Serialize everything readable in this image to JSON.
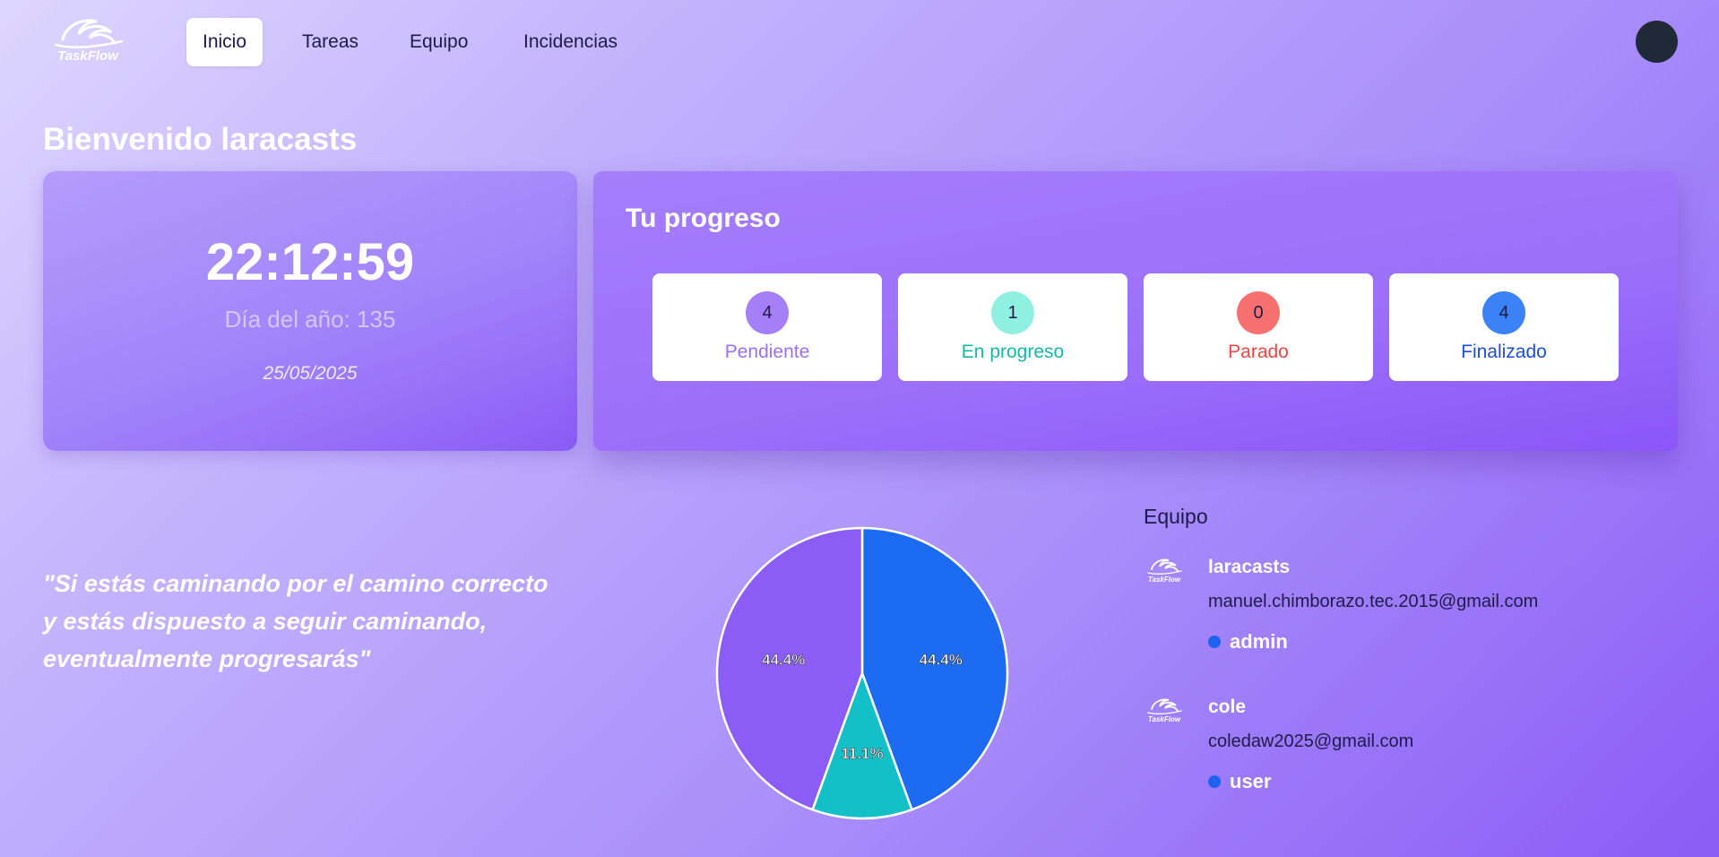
{
  "brand": {
    "logo_text": "TaskFlow"
  },
  "nav": {
    "items": [
      {
        "label": "Inicio",
        "active": true
      },
      {
        "label": "Tareas",
        "active": false
      },
      {
        "label": "Equipo",
        "active": false
      },
      {
        "label": "Incidencias",
        "active": false
      }
    ]
  },
  "welcome": "Bienvenido laracasts",
  "clock": {
    "time": "22:12:59",
    "day_of_year": "Día del año: 135",
    "date": "25/05/2025"
  },
  "progress": {
    "title": "Tu progreso",
    "stats": [
      {
        "count": "4",
        "label": "Pendiente",
        "color": "#a47ff8",
        "label_color": "#9a71f3"
      },
      {
        "count": "1",
        "label": "En progreso",
        "color": "#8ff0e0",
        "label_color": "#14b8a6"
      },
      {
        "count": "0",
        "label": "Parado",
        "color": "#f87171",
        "label_color": "#ef4444"
      },
      {
        "count": "4",
        "label": "Finalizado",
        "color": "#3b82f6",
        "label_color": "#1d4ed8"
      }
    ]
  },
  "quote": "\"Si estás caminando por el camino correcto y estás dispuesto a seguir caminando, eventualmente progresarás\"",
  "chart_data": {
    "type": "pie",
    "values": [
      4,
      1,
      4
    ],
    "slice_labels": [
      "44.4%",
      "11.1%",
      "44.4%"
    ],
    "colors": [
      "#1d6bf0",
      "#14c0c8",
      "#8b5cf6"
    ],
    "order": "clockwise-from-top"
  },
  "team": {
    "title": "Equipo",
    "members": [
      {
        "name": "laracasts",
        "email": "manuel.chimborazo.tec.2015@gmail.com",
        "role": "admin"
      },
      {
        "name": "cole",
        "email": "coledaw2025@gmail.com",
        "role": "user"
      }
    ]
  }
}
